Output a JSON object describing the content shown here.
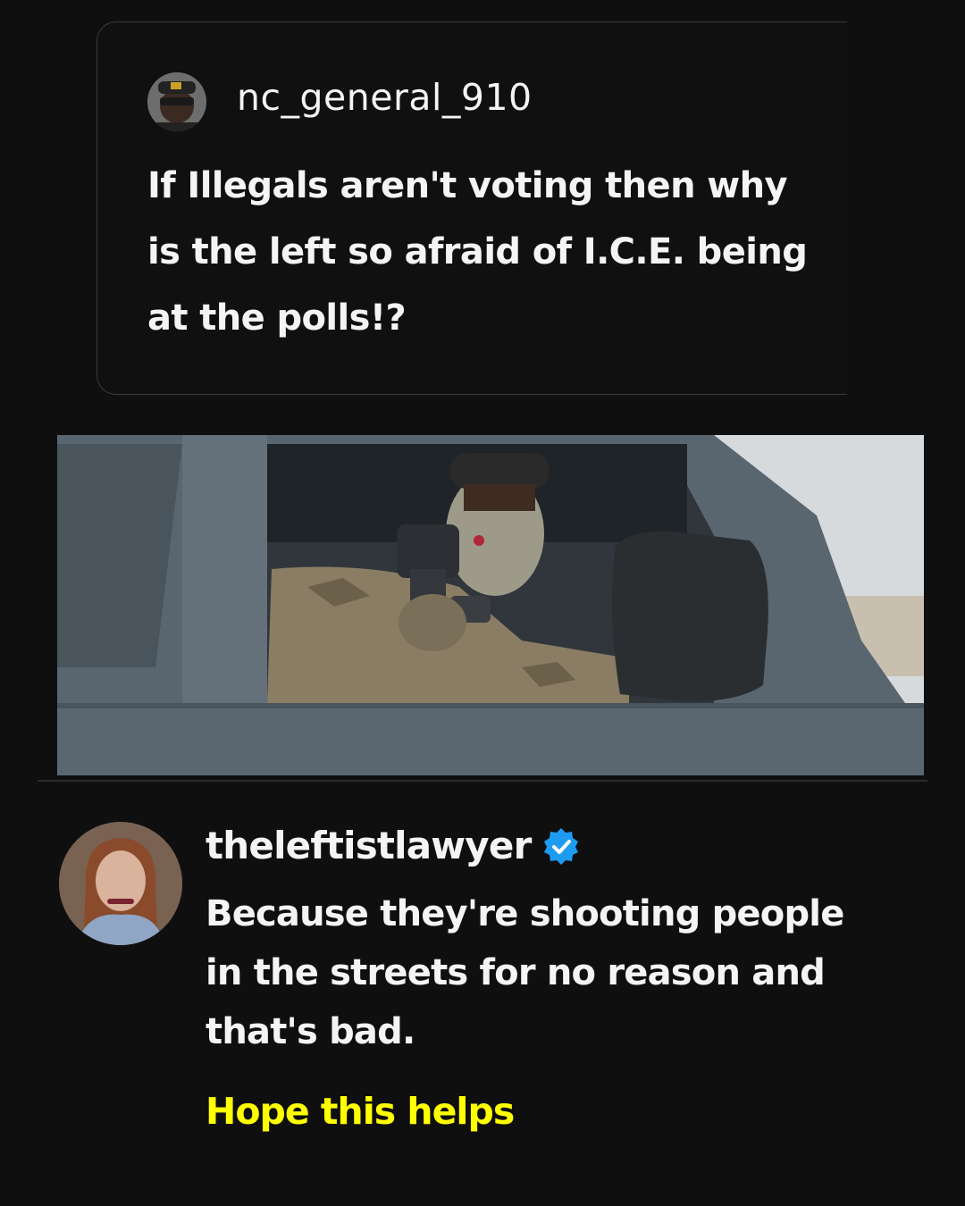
{
  "quoted_post": {
    "username": "nc_general_910",
    "text": "If Illegals aren't voting then why is the left so afraid of I.C.E. being at the polls!?",
    "avatar_icon": "user-avatar"
  },
  "media": {
    "image_icon": "photo-masked-man-in-truck-with-weapon"
  },
  "reply": {
    "username": "theleftistlawyer",
    "verified_icon": "verified-badge-icon",
    "verified_color": "#1d9bf0",
    "text": "Because they're shooting people in the streets for no reason and that's bad.",
    "highlight": "Hope this helps",
    "highlight_color": "#ffff00",
    "avatar_icon": "user-avatar"
  }
}
